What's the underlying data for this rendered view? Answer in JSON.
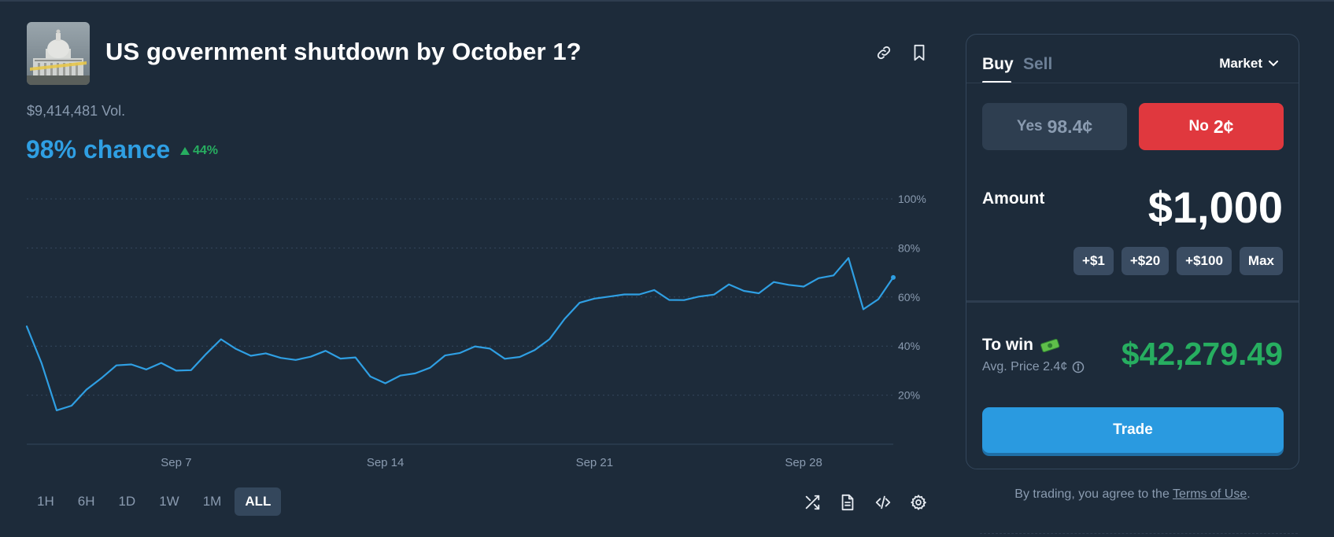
{
  "market": {
    "title": "US government shutdown by October 1?",
    "volume": "$9,414,481 Vol.",
    "chance": "98% chance",
    "change": "44%",
    "header_icons": [
      "link-icon",
      "bookmark-icon"
    ]
  },
  "chart_data": {
    "type": "line",
    "title": "",
    "xlabel": "",
    "ylabel": "",
    "ylim": [
      0,
      100
    ],
    "y_ticks": [
      "20%",
      "40%",
      "60%",
      "80%",
      "100%"
    ],
    "x_ticks": [
      "Sep 7",
      "Sep 14",
      "Sep 21",
      "Sep 28"
    ],
    "grid": true,
    "series": [
      {
        "color": "#2f9fe3",
        "x": [
          2.0,
          2.5,
          3.0,
          3.5,
          4.0,
          4.5,
          5.0,
          5.5,
          6.0,
          6.5,
          7.0,
          7.5,
          8.0,
          8.5,
          9.0,
          9.5,
          10.0,
          10.5,
          11.0,
          11.5,
          12.0,
          12.5,
          13.0,
          13.5,
          14.0,
          14.5,
          15.0,
          15.5,
          16.0,
          16.5,
          17.0,
          17.5,
          18.0,
          18.5,
          19.0,
          19.5,
          20.0,
          20.5,
          21.0,
          21.5,
          22.0,
          22.5,
          23.0,
          23.5,
          24.0,
          24.5,
          25.0,
          25.5,
          26.0,
          26.5,
          27.0,
          27.5,
          28.0,
          28.5,
          29.0,
          29.5,
          30.0,
          30.5,
          31.0
        ],
        "y": [
          48,
          32,
          15,
          15,
          22,
          28,
          31,
          33,
          31,
          32,
          31,
          30,
          36,
          44,
          38,
          36,
          38,
          34,
          35,
          36,
          37,
          36,
          35,
          27,
          26,
          27,
          29,
          32,
          35,
          38,
          40,
          38,
          36,
          35,
          38,
          44,
          50,
          58,
          60,
          59,
          62,
          61,
          62,
          60,
          58,
          60,
          62,
          64,
          63,
          62,
          65,
          66,
          64,
          67,
          70,
          75,
          55,
          60,
          68
        ]
      }
    ]
  },
  "ranges": [
    "1H",
    "6H",
    "1D",
    "1W",
    "1M",
    "ALL"
  ],
  "active_range": "ALL",
  "chart_tools": [
    "shuffle-icon",
    "document-icon",
    "code-icon",
    "gear-icon"
  ],
  "trade": {
    "tab_buy": "Buy",
    "tab_sell": "Sell",
    "order_type": "Market",
    "yes_label": "Yes",
    "yes_price": "98.4¢",
    "no_label": "No",
    "no_price": "2¢",
    "amount_label": "Amount",
    "amount_value": "$1,000",
    "increments": [
      "+$1",
      "+$20",
      "+$100",
      "Max"
    ],
    "to_win_label": "To win",
    "avg_price": "Avg. Price 2.4¢",
    "to_win_value": "$42,279.49",
    "trade_button": "Trade",
    "terms_prefix": "By trading, you agree to the ",
    "terms_link": "Terms of Use",
    "terms_suffix": ".",
    "colors": {
      "yes": "#2e3e50",
      "no": "#e0383e",
      "accent": "#2a9ae0",
      "win": "#27ae60"
    }
  }
}
